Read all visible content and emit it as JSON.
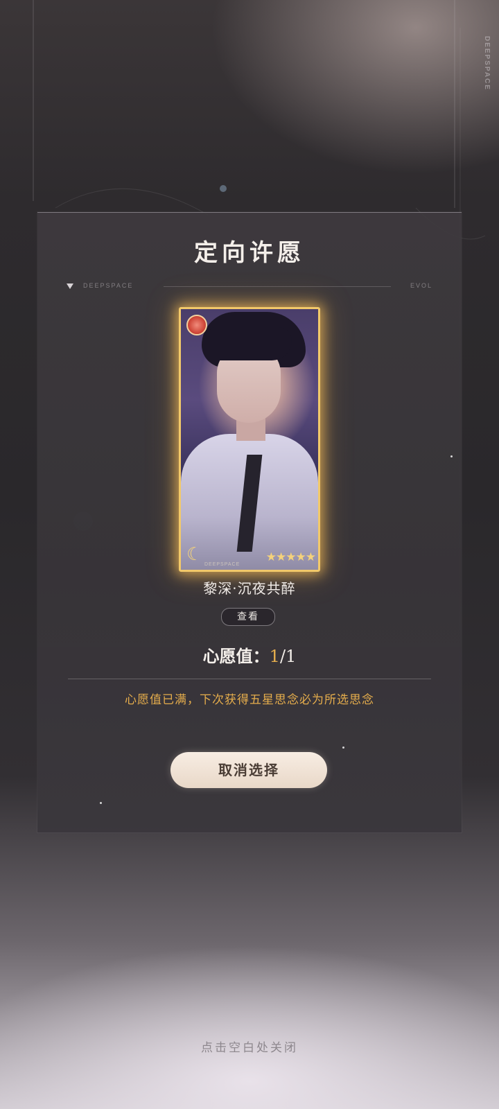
{
  "side_brand": "DEEPSPACE",
  "dialog": {
    "title": "定向许愿",
    "divider_left": "DEEPSPACE",
    "divider_right": "EVOL",
    "card": {
      "name": "黎深·沉夜共醉",
      "rarity_stars": 5,
      "stars_text": "★★★★★",
      "moon_icon": "☾",
      "brand": "DEEPSPACE"
    },
    "view_button": "查看",
    "wish": {
      "label": "心愿值：",
      "current": "1",
      "separator": "/",
      "max": "1"
    },
    "notice": "心愿值已满，下次获得五星思念必为所选思念",
    "cancel_button": "取消选择"
  },
  "close_hint": "点击空白处关闭",
  "colors": {
    "accent_gold": "#e5ad4c",
    "card_border": "#f2c96a",
    "button_bg": "#efe2d5"
  }
}
